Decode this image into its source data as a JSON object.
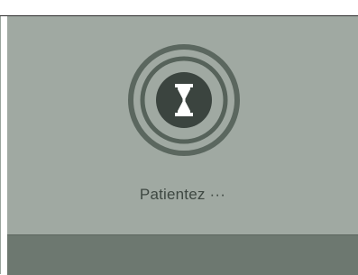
{
  "loading_dialog": {
    "message": "Patientez ···",
    "icon": "hourglass-icon"
  },
  "colors": {
    "dialog_background": "#a0a9a2",
    "bottom_bar": "#6d7870",
    "ring": "#556259",
    "inner_circle": "#3b443f",
    "hourglass": "#ffffff",
    "text": "#3e4842"
  }
}
